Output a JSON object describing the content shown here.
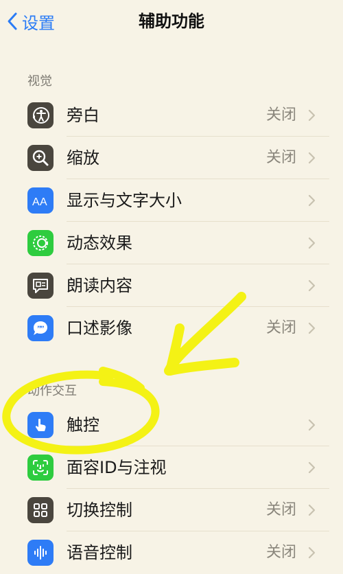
{
  "nav": {
    "back_label": "设置",
    "title": "辅助功能"
  },
  "sections": [
    {
      "header": "视觉",
      "items": [
        {
          "label": "旁白",
          "value": "关闭",
          "icon": "voiceover-icon",
          "color": "#4a463e"
        },
        {
          "label": "缩放",
          "value": "关闭",
          "icon": "zoom-icon",
          "color": "#4a463e"
        },
        {
          "label": "显示与文字大小",
          "value": "",
          "icon": "text-size-icon",
          "color": "#2e7cf6"
        },
        {
          "label": "动态效果",
          "value": "",
          "icon": "motion-icon",
          "color": "#2ecc3f"
        },
        {
          "label": "朗读内容",
          "value": "",
          "icon": "spoken-content-icon",
          "color": "#4a463e"
        },
        {
          "label": "口述影像",
          "value": "关闭",
          "icon": "audio-description-icon",
          "color": "#2e7cf6"
        }
      ]
    },
    {
      "header": "动作交互",
      "items": [
        {
          "label": "触控",
          "value": "",
          "icon": "touch-icon",
          "color": "#2e7cf6"
        },
        {
          "label": "面容ID与注视",
          "value": "",
          "icon": "face-id-icon",
          "color": "#2ecc3f"
        },
        {
          "label": "切换控制",
          "value": "关闭",
          "icon": "switch-control-icon",
          "color": "#4a463e"
        },
        {
          "label": "语音控制",
          "value": "关闭",
          "icon": "voice-control-icon",
          "color": "#2e7cf6"
        }
      ]
    }
  ],
  "annotation_color": "#f4f215"
}
